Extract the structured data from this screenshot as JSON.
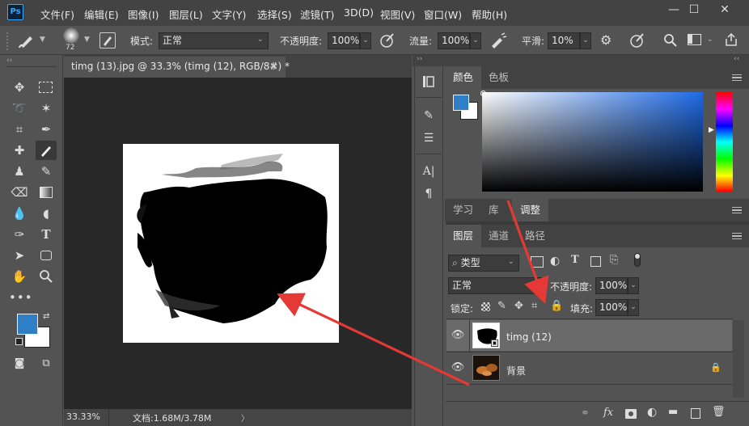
{
  "app": {
    "logo": "Ps"
  },
  "menu": [
    "文件(F)",
    "编辑(E)",
    "图像(I)",
    "图层(L)",
    "文字(Y)",
    "选择(S)",
    "滤镜(T)",
    "3D(D)",
    "视图(V)",
    "窗口(W)",
    "帮助(H)"
  ],
  "window_controls": {
    "minimize": "—",
    "maximize": "☐",
    "close": "✕"
  },
  "options": {
    "brush_size": "72",
    "mode_label": "模式:",
    "mode_value": "正常",
    "opacity_label": "不透明度:",
    "opacity_value": "100%",
    "flow_label": "流量:",
    "flow_value": "100%",
    "smooth_label": "平滑:",
    "smooth_value": "10%"
  },
  "document": {
    "tab_title": "timg (13).jpg @ 33.3% (timg (12), RGB/8#) *",
    "tab_close": "×",
    "zoom": "33.33%",
    "doc_info": "文档:1.68M/3.78M",
    "status_arrow": "〉"
  },
  "color_panel": {
    "tabs": [
      "颜色",
      "色板"
    ],
    "fg_color": "#2e7fc6",
    "bg_color": "#ffffff"
  },
  "mid_panel": {
    "tabs": [
      "学习",
      "库",
      "调整"
    ]
  },
  "layers_panel": {
    "tabs": [
      "图层",
      "通道",
      "路径"
    ],
    "filter_label": "类型",
    "blend_mode": "正常",
    "opacity_label": "不透明度:",
    "opacity_value": "100%",
    "lock_label": "锁定:",
    "fill_label": "填充:",
    "fill_value": "100%",
    "layers": [
      {
        "name": "timg (12)",
        "selected": true
      },
      {
        "name": "背景",
        "selected": false,
        "locked": true
      }
    ]
  },
  "colors": {
    "accent": "#2e7fc6",
    "annotation_arrow": "#e53935"
  }
}
